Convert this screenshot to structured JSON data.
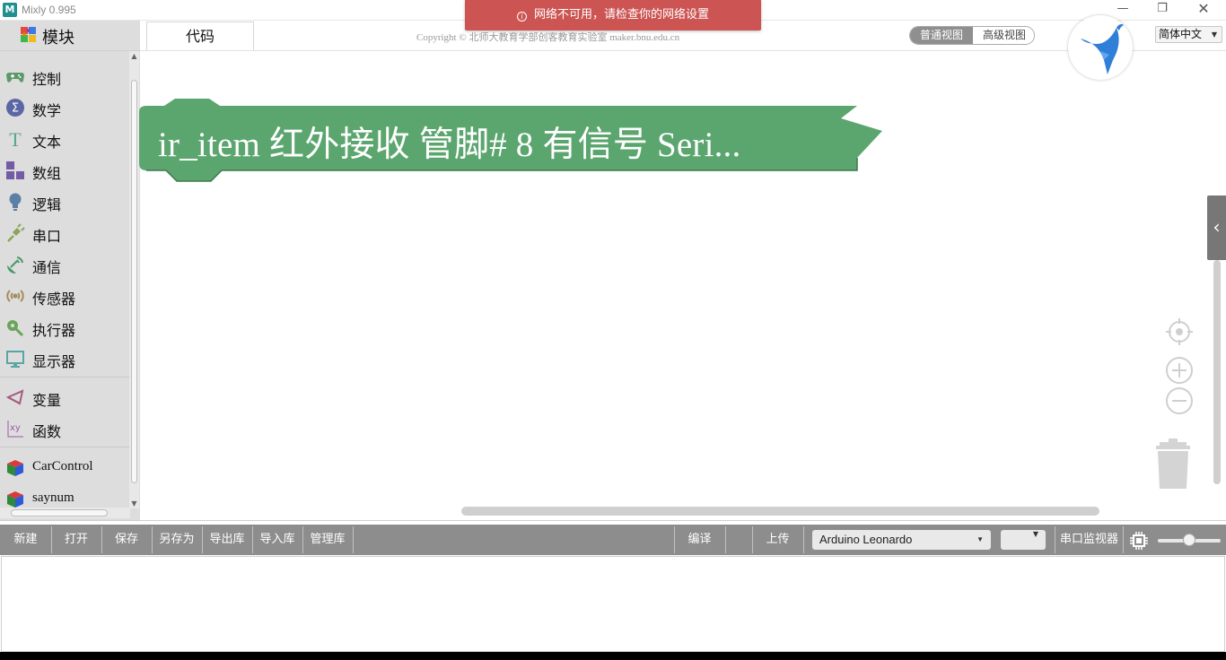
{
  "window": {
    "title": "Mixly 0.995",
    "app_icon_glyph": "M",
    "controls": {
      "minimize": "—",
      "maximize": "❐",
      "close": "✕"
    }
  },
  "notification": {
    "icon": "info-icon",
    "text": "网络不可用，请检查你的网络设置",
    "color": "#cc5553"
  },
  "sidebar": {
    "header_label": "模块",
    "categories": [
      {
        "label": "控制",
        "icon": "gamepad-icon",
        "color": "#5b9a68"
      },
      {
        "label": "数学",
        "icon": "sigma-icon",
        "color": "#5b67a5"
      },
      {
        "label": "文本",
        "icon": "text-icon",
        "color": "#5ba58c"
      },
      {
        "label": "数组",
        "icon": "array-icon",
        "color": "#745ba5"
      },
      {
        "label": "逻辑",
        "icon": "bulb-icon",
        "color": "#5b80a5"
      },
      {
        "label": "串口",
        "icon": "plug-icon",
        "color": "#8aa55b"
      },
      {
        "label": "通信",
        "icon": "satellite-icon",
        "color": "#4a9a6a"
      },
      {
        "label": "传感器",
        "icon": "sensor-icon",
        "color": "#a58a5b"
      },
      {
        "label": "执行器",
        "icon": "actuator-icon",
        "color": "#6aa55b"
      },
      {
        "label": "显示器",
        "icon": "monitor-icon",
        "color": "#5ba5a5"
      },
      {
        "label": "变量",
        "icon": "variable-icon",
        "color": "#a55b80"
      },
      {
        "label": "函数",
        "icon": "function-icon",
        "color": "#995ba5"
      },
      {
        "label": "CarControl",
        "icon": "cube-icon",
        "color": "#2d8a3a"
      },
      {
        "label": "saynum",
        "icon": "cube-icon",
        "color": "#2d8a3a"
      }
    ]
  },
  "workspace": {
    "tab_label": "代码",
    "copyright": "Copyright © 北师大教育学部创客教育实验室 maker.bnu.edu.cn",
    "view_options": {
      "normal": "普通视图",
      "advanced": "高级视图",
      "active": "普通视图"
    },
    "language_selected": "简体中文",
    "block": {
      "text": "ir_item 红外接收 管脚# 8 有信号 Seri...",
      "color": "#5ba56e"
    }
  },
  "toolbar": {
    "new": "新建",
    "open": "打开",
    "save": "保存",
    "save_as": "另存为",
    "export_lib": "导出库",
    "import_lib": "导入库",
    "manage_lib": "管理库",
    "compile": "编译",
    "upload": "上传",
    "board_selected": "Arduino Leonardo",
    "port_selected": "",
    "serial_monitor": "串口监视器"
  },
  "output": {
    "text": ""
  },
  "colors": {
    "toolbar_bg": "#8d8d8d",
    "sidebar_bg": "#dddddd",
    "accent_red": "#cc5553"
  }
}
